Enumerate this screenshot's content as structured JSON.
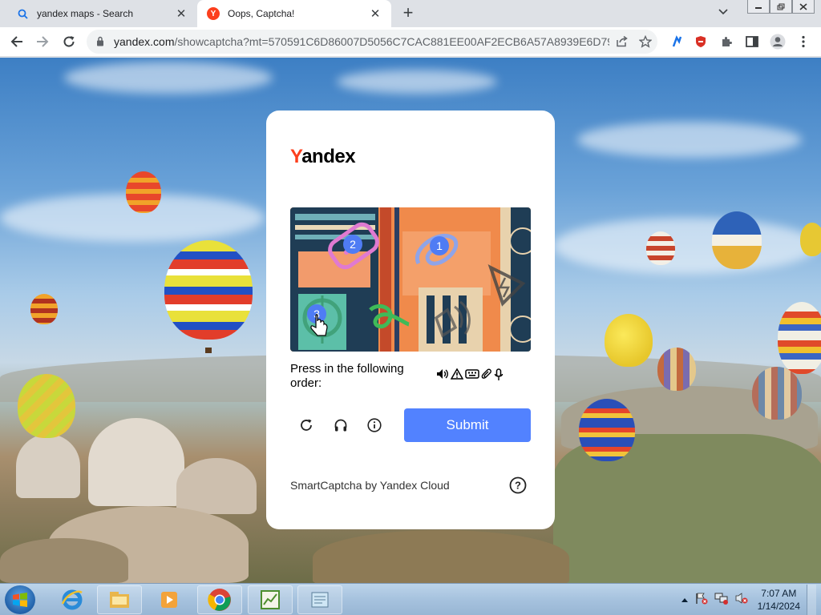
{
  "browser": {
    "tabs": [
      {
        "title": "yandex maps - Search",
        "icon": "search-icon",
        "active": false
      },
      {
        "title": "Oops, Captcha!",
        "icon": "yandex-favicon",
        "active": true
      }
    ],
    "new_tab_label": "+",
    "url_host": "yandex.com",
    "url_path": "/showcaptcha?mt=570591C6D86007D5056C7CAC881EE00AF2ECB6A57A8939E6D79..."
  },
  "captcha": {
    "logo_first_letter": "Y",
    "logo_rest": "andex",
    "prompt": "Press in the following order:",
    "order_icons": [
      "🔊",
      "⚠",
      "⌨",
      "📎",
      "🎤"
    ],
    "marker_labels": [
      "1",
      "2",
      "3"
    ],
    "submit_label": "Submit",
    "footer": "SmartCaptcha by Yandex Cloud",
    "help_label": "?"
  },
  "taskbar": {
    "time": "7:07 AM",
    "date": "1/14/2024"
  },
  "colors": {
    "yandex_red": "#fc3f1d",
    "submit_blue": "#5282ff",
    "marker_blue": "#4f7cf4"
  }
}
